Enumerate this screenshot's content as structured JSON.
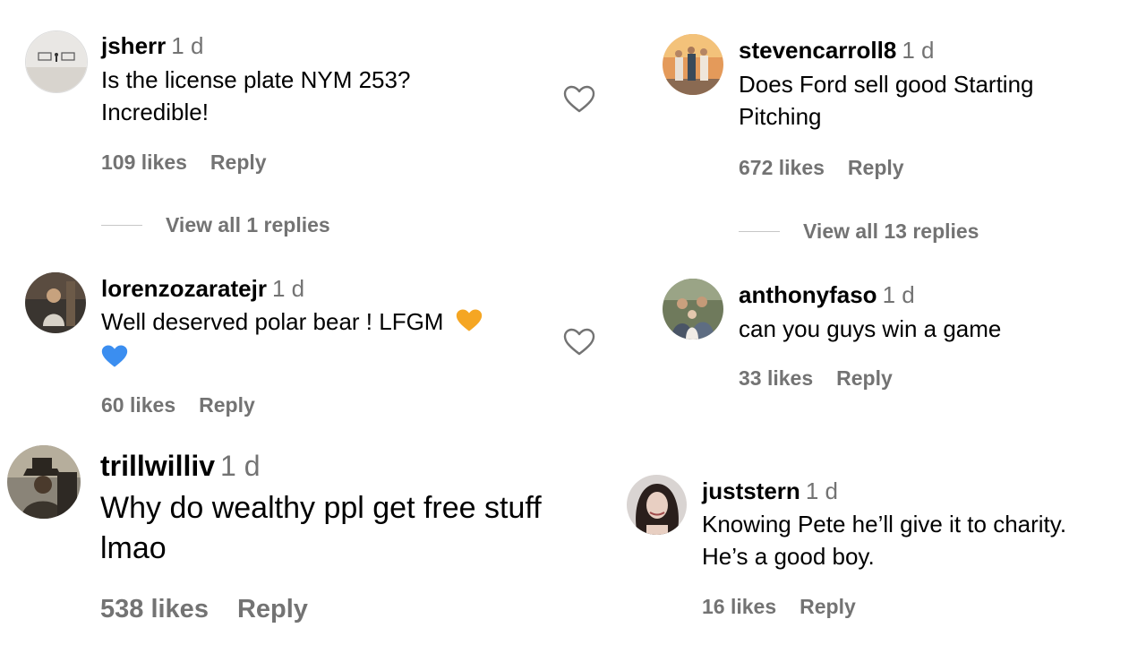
{
  "comments": [
    {
      "username": "jsherr",
      "time": "1 d",
      "lines": [
        "Is the license plate NYM 253?",
        "Incredible!"
      ],
      "likes": "109 likes",
      "reply": "Reply",
      "view_replies": "View all 1 replies",
      "avatar_icon": "beach-photo-avatar"
    },
    {
      "username": "lorenzozaratejr",
      "time": "1 d",
      "lines": [
        "Well deserved polar bear ! LFGM"
      ],
      "emojis": [
        "orange-heart-icon",
        "blue-heart-icon"
      ],
      "likes": "60 likes",
      "reply": "Reply",
      "avatar_icon": "man-photo-avatar"
    },
    {
      "username": "trillwilliv",
      "time": "1 d",
      "lines": [
        "Why do wealthy ppl get free stuff",
        "lmao"
      ],
      "likes": "538 likes",
      "reply": "Reply",
      "avatar_icon": "cowboy-photo-avatar"
    },
    {
      "username": "stevencarroll8",
      "time": "1 d",
      "lines": [
        "Does Ford sell good Starting",
        "Pitching"
      ],
      "likes": "672 likes",
      "reply": "Reply",
      "view_replies": "View all 13 replies",
      "avatar_icon": "group-sunset-avatar"
    },
    {
      "username": "anthonyfaso",
      "time": "1 d",
      "lines": [
        "can you guys win a game"
      ],
      "likes": "33 likes",
      "reply": "Reply",
      "avatar_icon": "family-photo-avatar"
    },
    {
      "username": "juststern",
      "time": "1 d",
      "lines": [
        "Knowing Pete he’ll give it to charity.",
        "He’s a good boy."
      ],
      "likes": "16 likes",
      "reply": "Reply",
      "avatar_icon": "woman-photo-avatar"
    }
  ],
  "colors": {
    "secondary_text": "#737373",
    "divider": "#c7c7c7",
    "orange_heart": "#f5a623",
    "blue_heart": "#3b8ef0"
  }
}
